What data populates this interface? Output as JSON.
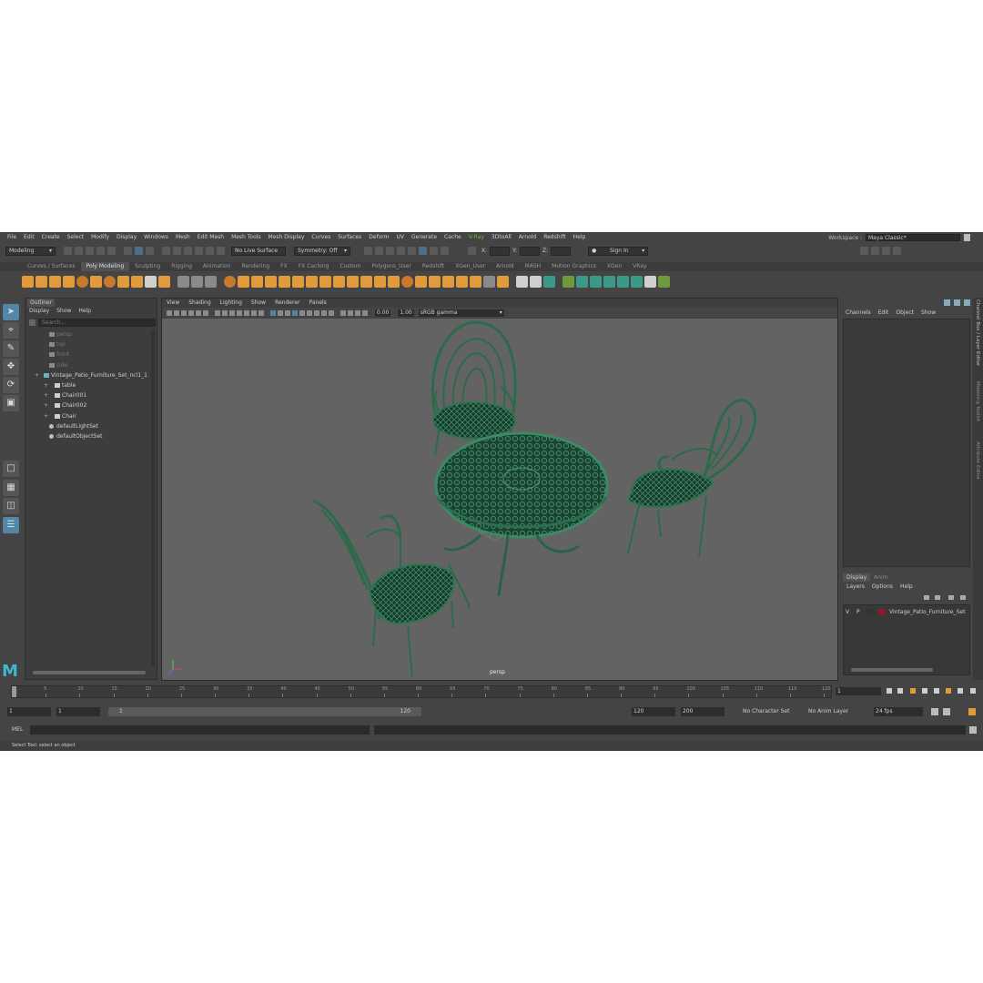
{
  "menubar": {
    "items": [
      "File",
      "Edit",
      "Create",
      "Select",
      "Modify",
      "Display",
      "Windows",
      "Mesh",
      "Edit Mesh",
      "Mesh Tools",
      "Mesh Display",
      "Curves",
      "Surfaces",
      "Deform",
      "UV",
      "Generate",
      "Cache",
      "V-Ray",
      "3DtoAll",
      "Arnold",
      "Redshift",
      "Help"
    ],
    "workspace_label": "Workspace :",
    "workspace_value": "Maya Classic*"
  },
  "statusline": {
    "mode": "Modeling",
    "live_surface": "No Live Surface",
    "symmetry": "Symmetry: Off",
    "x_label": "X:",
    "y_label": "Y:",
    "z_label": "Z:",
    "sign_in": "Sign In"
  },
  "shelf": {
    "tabs": [
      "Curves / Surfaces",
      "Poly Modeling",
      "Sculpting",
      "Rigging",
      "Animation",
      "Rendering",
      "FX",
      "FX Caching",
      "Custom",
      "Polygons_User",
      "Redshift",
      "XGen_User",
      "Arnold",
      "MASH",
      "Motion Graphics",
      "XGen",
      "VRay"
    ],
    "active_tab": "Poly Modeling"
  },
  "outliner": {
    "title": "Outliner",
    "menu": [
      "Display",
      "Show",
      "Help"
    ],
    "search_placeholder": "Search...",
    "items": [
      {
        "label": "persp",
        "indent": 1,
        "kind": "camera",
        "dim": true
      },
      {
        "label": "top",
        "indent": 1,
        "kind": "camera",
        "dim": true
      },
      {
        "label": "front",
        "indent": 1,
        "kind": "camera",
        "dim": true
      },
      {
        "label": "side",
        "indent": 1,
        "kind": "camera",
        "dim": true
      },
      {
        "label": "Vintage_Patio_Furniture_Set_ncl1_1",
        "indent": 0,
        "kind": "group",
        "dim": false
      },
      {
        "label": "table",
        "indent": 2,
        "kind": "mesh",
        "dim": false
      },
      {
        "label": "Chair001",
        "indent": 2,
        "kind": "mesh",
        "dim": false
      },
      {
        "label": "Chair002",
        "indent": 2,
        "kind": "mesh",
        "dim": false
      },
      {
        "label": "Chair",
        "indent": 2,
        "kind": "mesh",
        "dim": false
      },
      {
        "label": "defaultLightSet",
        "indent": 1,
        "kind": "set",
        "dim": false
      },
      {
        "label": "defaultObjectSet",
        "indent": 1,
        "kind": "set",
        "dim": false
      }
    ]
  },
  "viewport": {
    "menu": [
      "View",
      "Shading",
      "Lighting",
      "Show",
      "Renderer",
      "Panels"
    ],
    "exposure": "0.00",
    "gamma": "1.00",
    "color_space": "sRGB gamma",
    "camera_label": "persp",
    "background": "#636363",
    "model_color": "#1f4a36"
  },
  "channelbox": {
    "menu": [
      "Channels",
      "Edit",
      "Object",
      "Show"
    ]
  },
  "layer_editor": {
    "tabs": [
      "Display",
      "Anim"
    ],
    "active_tab": "Display",
    "menu": [
      "Layers",
      "Options",
      "Help"
    ],
    "layer": {
      "v": "V",
      "p": "P",
      "name": "Vintage_Patio_Furniture_Set",
      "color": "#8b1a2b"
    }
  },
  "side_tabs": [
    "Channel Box / Layer Editor",
    "Modeling Toolkit",
    "Attribute Editor"
  ],
  "timeline": {
    "ticks": [
      "5",
      "10",
      "15",
      "20",
      "25",
      "30",
      "35",
      "40",
      "45",
      "50",
      "55",
      "60",
      "65",
      "70",
      "75",
      "80",
      "85",
      "90",
      "95",
      "100",
      "105",
      "110",
      "115",
      "120"
    ],
    "current_frame": "1"
  },
  "range": {
    "start": "1",
    "playback_start": "1",
    "slider_start": "1",
    "slider_end": "120",
    "playback_end": "120",
    "end": "200",
    "character_set": "No Character Set",
    "anim_layer": "No Anim Layer",
    "fps": "24 fps"
  },
  "command": {
    "label": "MEL"
  },
  "help_line": "Select Tool: select an object"
}
